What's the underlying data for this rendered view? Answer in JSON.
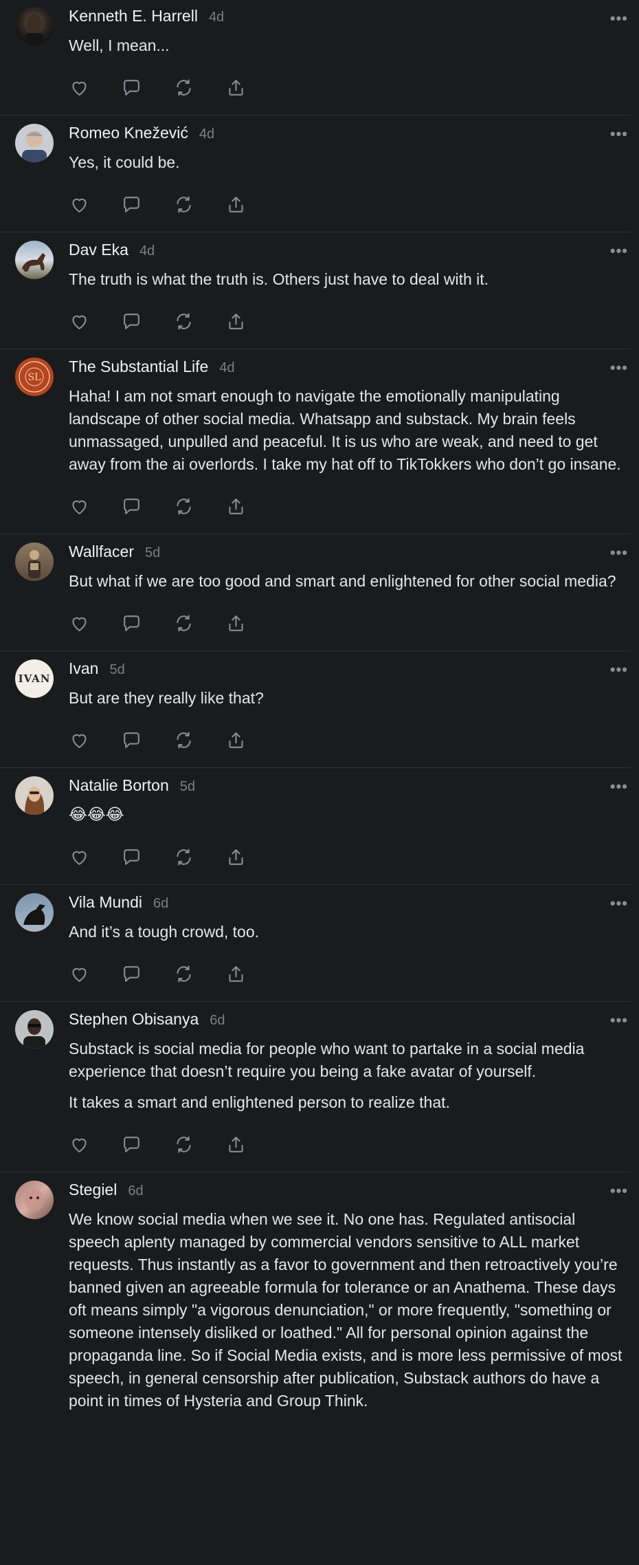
{
  "comments": [
    {
      "author": "Kenneth E. Harrell",
      "time": "4d",
      "paragraphs": [
        "Well, I mean..."
      ],
      "avatar": "photo-dark-portrait"
    },
    {
      "author": "Romeo Knežević",
      "time": "4d",
      "paragraphs": [
        "Yes, it could be."
      ],
      "avatar": "photo-gray-hair"
    },
    {
      "author": "Dav Eka",
      "time": "4d",
      "paragraphs": [
        "The truth is what the truth is. Others just have to deal with it."
      ],
      "avatar": "photo-horse"
    },
    {
      "author": "The Substantial Life",
      "time": "4d",
      "paragraphs": [
        "Haha! I am not smart enough to navigate the emotionally manipulating landscape of other social media. Whatsapp and substack. My brain feels unmassaged, unpulled and peaceful. It is us who are weak, and need to get away from the ai overlords. I take my hat off to TikTokkers who don’t go insane."
      ],
      "avatar": "logo-orange-seal"
    },
    {
      "author": "Wallfacer",
      "time": "5d",
      "paragraphs": [
        "But what if we are too good and smart and enlightened for other social media?"
      ],
      "avatar": "photo-figure"
    },
    {
      "author": "Ivan",
      "time": "5d",
      "paragraphs": [
        "But are they really like that?"
      ],
      "avatar": "logo-ivan-text",
      "avatar_text": "IVAN"
    },
    {
      "author": "Natalie Borton",
      "time": "5d",
      "paragraphs": [
        "😂😂😂"
      ],
      "avatar": "photo-woman"
    },
    {
      "author": "Vila Mundi",
      "time": "6d",
      "paragraphs": [
        "And it’s a tough crowd, too."
      ],
      "avatar": "photo-bird"
    },
    {
      "author": "Stephen Obisanya",
      "time": "6d",
      "paragraphs": [
        "Substack is social media for people who want to partake in a social media experience that doesn’t require you being a fake avatar of yourself.",
        "It takes a smart and enlightened person to realize that."
      ],
      "avatar": "photo-man-sunglasses"
    },
    {
      "author": "Stegiel",
      "time": "6d",
      "paragraphs": [
        "We know social media when we see it. No one has. Regulated antisocial speech aplenty managed by commercial vendors sensitive to ALL market requests. Thus instantly as a favor to government and then retroactively you’re banned given an agreeable formula for tolerance or an Anathema. These days oft means simply \"a vigorous denunciation,\" or more frequently, \"something or someone intensely disliked or loathed.\" All for personal opinion against the propaganda line. So if Social Media exists, and is more less permissive of most speech, in general censorship after publication, Substack authors do have a point in times of Hysteria and Group Think."
      ],
      "avatar": "photo-pink-face"
    }
  ],
  "icons": {
    "like": "heart-icon",
    "reply": "comment-icon",
    "restack": "restack-icon",
    "share": "share-icon",
    "more": "more-icon"
  },
  "colors": {
    "background": "#1a1b1d",
    "text": "#e6e6e6",
    "muted": "#7c7f84",
    "divider": "#2e3033"
  }
}
